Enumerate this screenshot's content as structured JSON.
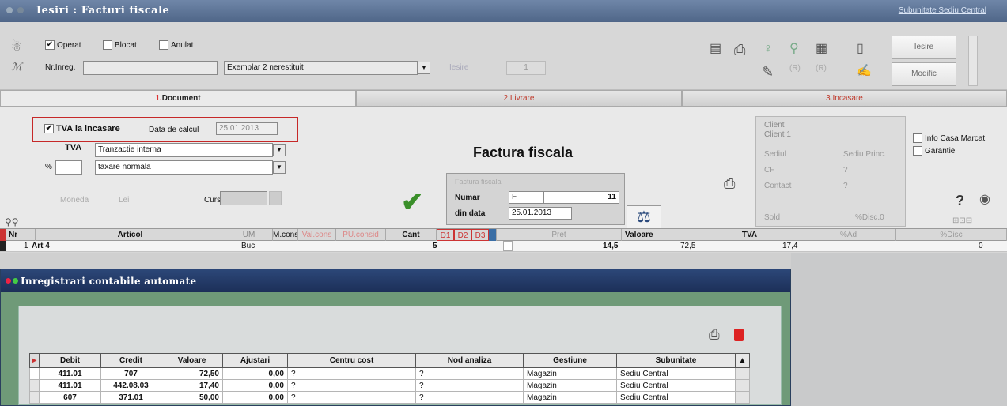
{
  "window": {
    "title": "Iesiri : Facturi fiscale",
    "subunit_link": "Subunitate Sediu Central"
  },
  "toolbar": {
    "operat": "Operat",
    "blocat": "Blocat",
    "anulat": "Anulat",
    "nr_inreg": "Nr.Inreg.",
    "exemplar": "Exemplar 2 nerestituit",
    "iesire": "Iesire",
    "modific": "Modific",
    "faded": "Iesire",
    "faded_num": "1"
  },
  "tabs": [
    {
      "num": "1.",
      "label": "Document"
    },
    {
      "num": "2.",
      "label": "Livrare"
    },
    {
      "num": "3.",
      "label": "Incasare"
    }
  ],
  "doc": {
    "tva_incasare": "TVA la incasare",
    "data_calcul_label": "Data de calcul",
    "data_calcul": "25.01.2013",
    "tva_label": "TVA",
    "tva_value": "Tranzactie interna",
    "pct_label": "%",
    "taxare": "taxare normala",
    "moneda_label": "Moneda",
    "moneda": "Lei",
    "curs_label": "Curs",
    "title": "Factura fiscala",
    "ff_caption": "Factura fiscala",
    "numar_label": "Numar",
    "numar_prefix": "F",
    "numar": "11",
    "data_label": "din data",
    "data": "25.01.2013",
    "client": "Client",
    "client_name": "Client 1",
    "sediul": "Sediul",
    "sediul_val": "Sediu Princ.",
    "cf": "CF",
    "cf_val": "?",
    "contact": "Contact",
    "contact_val": "?",
    "sold": "Sold",
    "discount": "%Disc.0",
    "info_casa": "Info Casa Marcat",
    "garantie": "Garantie"
  },
  "grid": {
    "headers": [
      "Nr",
      "Articol",
      "UM",
      "M.cons",
      "Val.cons",
      "PU.consid",
      "Cant",
      "D1",
      "D2",
      "D3",
      "Pret",
      "Valoare",
      "TVA",
      "%Ad",
      "%Disc"
    ],
    "row": {
      "nr": "1",
      "articol": "Art 4",
      "um": "Buc",
      "cant": "5",
      "pret": "14,5",
      "valoare": "72,5",
      "tva": "17,4",
      "disc": "0"
    }
  },
  "dialog": {
    "title": "Inregistrari contabile automate",
    "headers": [
      "Debit",
      "Credit",
      "Valoare",
      "Ajustari",
      "Centru cost",
      "Nod analiza",
      "Gestiune",
      "Subunitate"
    ],
    "rows": [
      [
        "411.01",
        "707",
        "72,50",
        "0,00",
        "?",
        "?",
        "Magazin",
        "Sediu Central"
      ],
      [
        "411.01",
        "442.08.03",
        "17,40",
        "0,00",
        "?",
        "?",
        "Magazin",
        "Sediu Central"
      ],
      [
        "607",
        "371.01",
        "50,00",
        "0,00",
        "?",
        "?",
        "Magazin",
        "Sediu Central"
      ]
    ]
  },
  "colors": {
    "titlebar": "#5a7196",
    "dialog_bar": "#24396a",
    "dialog_bg": "#6f9a78",
    "red_highlight": "#c62828",
    "checkmark": "#3a8f2a"
  }
}
